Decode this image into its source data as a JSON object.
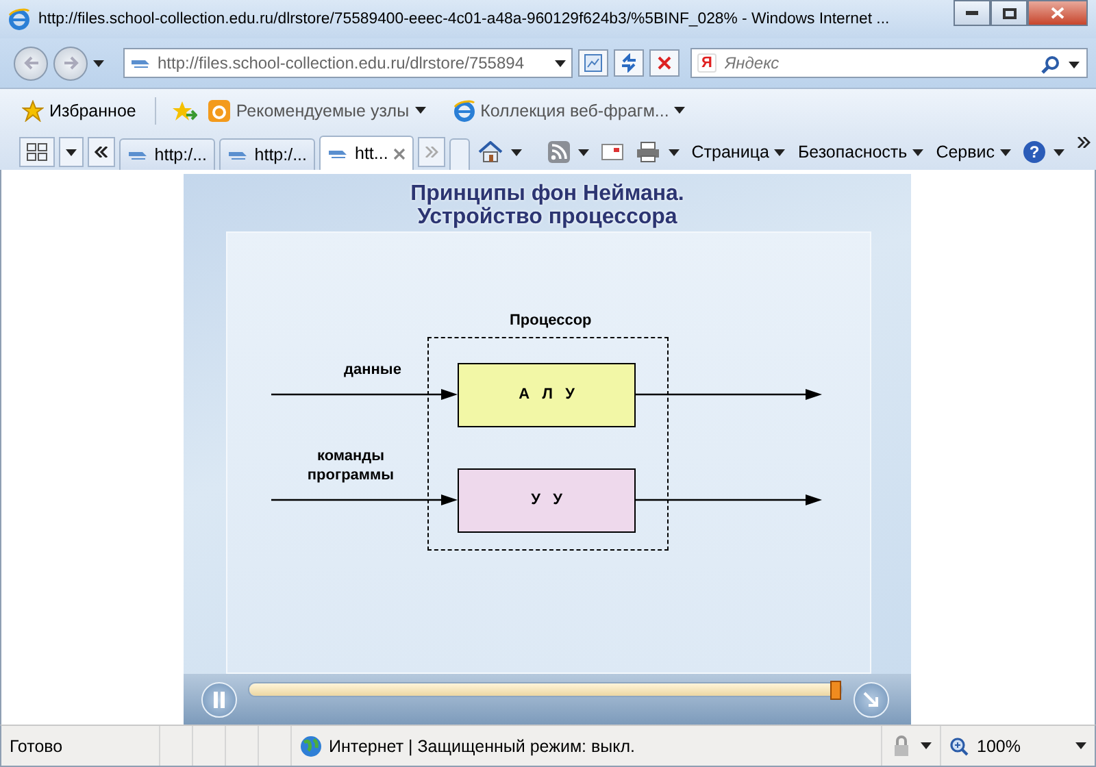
{
  "window": {
    "title": "http://files.school-collection.edu.ru/dlrstore/75589400-eeec-4c01-a48a-960129f624b3/%5BINF_028% - Windows Internet ..."
  },
  "address_bar": {
    "value": "http://files.school-collection.edu.ru/dlrstore/755894"
  },
  "search": {
    "engine_badge": "Я",
    "placeholder": "Яндекс"
  },
  "help_button": "?",
  "favorites_bar": {
    "favorites": "Избранное",
    "items": [
      "Рекомендуемые узлы",
      "Коллекция веб-фрагм..."
    ]
  },
  "tabs": [
    {
      "label": "http:/...",
      "selected": false
    },
    {
      "label": "http:/...",
      "selected": false
    },
    {
      "label": "htt...",
      "selected": true
    }
  ],
  "commands": [
    "Страница",
    "Безопасность",
    "Сервис"
  ],
  "slide": {
    "title": "Принципы фон Неймана.",
    "subtitle": "Устройство процессора",
    "diagram": {
      "processor_label": "Процессор",
      "inputs": [
        "данные",
        "команды программы"
      ],
      "blocks": [
        {
          "label": "А   Л   У",
          "color": "#f2f7a6"
        },
        {
          "label": "У   У",
          "color": "#eed9ec"
        }
      ]
    },
    "progress": {
      "level": 0.99
    }
  },
  "status_bar": {
    "status": "Готово",
    "zone": "Интернет | Защищенный режим: выкл.",
    "zoom": "100%"
  }
}
